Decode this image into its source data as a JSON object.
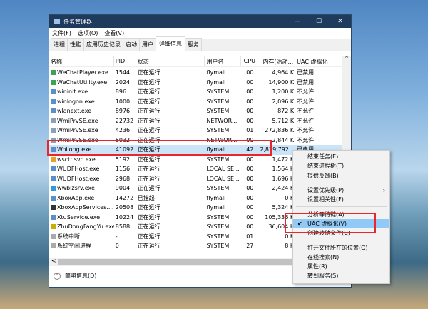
{
  "window": {
    "title": "任务管理器",
    "controls": [
      "—",
      "☐",
      "✕"
    ]
  },
  "menubar": [
    "文件(F)",
    "选项(O)",
    "查看(V)"
  ],
  "tabs": [
    {
      "label": "进程"
    },
    {
      "label": "性能"
    },
    {
      "label": "应用历史记录"
    },
    {
      "label": "启动"
    },
    {
      "label": "用户"
    },
    {
      "label": "详细信息",
      "active": true
    },
    {
      "label": "服务"
    }
  ],
  "columns": [
    "名称",
    "PID",
    "状态",
    "用户名",
    "CPU",
    "内存(活动...",
    "UAC 虚拟化"
  ],
  "rows": [
    [
      "WeChatPlayer.exe",
      "1544",
      "正在运行",
      "flymali",
      "00",
      "4,964 K",
      "已禁用"
    ],
    [
      "WeChatUtility.exe",
      "2024",
      "正在运行",
      "flymali",
      "00",
      "14,900 K",
      "已禁用"
    ],
    [
      "wininit.exe",
      "896",
      "正在运行",
      "SYSTEM",
      "00",
      "1,200 K",
      "不允许"
    ],
    [
      "winlogon.exe",
      "1000",
      "正在运行",
      "SYSTEM",
      "00",
      "2,096 K",
      "不允许"
    ],
    [
      "wlanext.exe",
      "8976",
      "正在运行",
      "SYSTEM",
      "00",
      "872 K",
      "不允许"
    ],
    [
      "WmiPrvSE.exe",
      "22732",
      "正在运行",
      "NETWOR...",
      "00",
      "5,712 K",
      "不允许"
    ],
    [
      "WmiPrvSE.exe",
      "4236",
      "正在运行",
      "SYSTEM",
      "01",
      "272,836 K",
      "不允许"
    ],
    [
      "WmiPrvSE.exe",
      "5032",
      "正在运行",
      "NETWOR...",
      "00",
      "2,844 K",
      "不允许"
    ],
    [
      "WoLong.exe",
      "41092",
      "正在运行",
      "flymali",
      "42",
      "2,829,792...",
      "已启用"
    ],
    [
      "wsctrlsvc.exe",
      "5192",
      "正在运行",
      "SYSTEM",
      "00",
      "1,472 K",
      ""
    ],
    [
      "WUDFHost.exe",
      "1156",
      "正在运行",
      "LOCAL SE...",
      "00",
      "1,564 K",
      ""
    ],
    [
      "WUDFHost.exe",
      "2968",
      "正在运行",
      "LOCAL SE...",
      "00",
      "1,696 K",
      ""
    ],
    [
      "wwbizsrv.exe",
      "9004",
      "正在运行",
      "SYSTEM",
      "00",
      "2,424 K",
      ""
    ],
    [
      "XboxApp.exe",
      "14272",
      "已挂起",
      "flymali",
      "00",
      "0 K",
      ""
    ],
    [
      "XboxAppServices....",
      "20508",
      "正在运行",
      "flymali",
      "00",
      "5,324 K",
      ""
    ],
    [
      "XtuService.exe",
      "10224",
      "正在运行",
      "SYSTEM",
      "00",
      "105,336 K",
      ""
    ],
    [
      "ZhuDongFangYu.exe",
      "8588",
      "正在运行",
      "SYSTEM",
      "00",
      "36,604 K",
      ""
    ],
    [
      "系统中断",
      "-",
      "正在运行",
      "SYSTEM",
      "01",
      "0 K",
      ""
    ],
    [
      "系统空闲进程",
      "0",
      "正在运行",
      "SYSTEM",
      "27",
      "8 K",
      ""
    ]
  ],
  "selected_row": 8,
  "footer": {
    "label": "简略信息(D)"
  },
  "context_menu": [
    {
      "label": "结束任务(E)"
    },
    {
      "label": "结束进程树(T)"
    },
    {
      "label": "提供反馈(B)"
    },
    {
      "sep": true
    },
    {
      "label": "设置优先级(P)",
      "submenu": true
    },
    {
      "label": "设置相关性(F)"
    },
    {
      "sep": true
    },
    {
      "label": "分析等待链(A)"
    },
    {
      "label": "UAC 虚拟化(V)",
      "checked": true,
      "highlighted": true
    },
    {
      "label": "创建转储文件(C)"
    },
    {
      "sep": true
    },
    {
      "label": "打开文件所在的位置(O)"
    },
    {
      "label": "在线搜索(N)"
    },
    {
      "label": "属性(R)"
    },
    {
      "label": "转到服务(S)"
    }
  ],
  "colors": {
    "titlebar": "#1e3a5c",
    "selection": "#cce4f7",
    "menu_highlight": "#91c9f7",
    "annotation": "#e8262b"
  }
}
